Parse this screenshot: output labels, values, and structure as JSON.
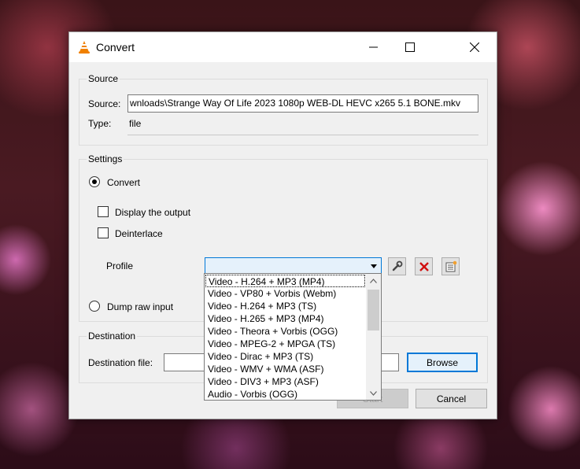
{
  "window": {
    "title": "Convert",
    "icon": "vlc-cone-icon",
    "controls": [
      "minimize-icon",
      "maximize-icon",
      "close-icon"
    ]
  },
  "source": {
    "group_label": "Source",
    "source_label": "Source:",
    "source_value": "wnloads\\Strange Way Of Life 2023 1080p WEB-DL HEVC x265 5.1 BONE.mkv",
    "type_label": "Type:",
    "type_value": "file"
  },
  "settings": {
    "group_label": "Settings",
    "convert_label": "Convert",
    "convert_selected": true,
    "display_output_label": "Display the output",
    "display_output_checked": false,
    "deinterlace_label": "Deinterlace",
    "deinterlace_checked": false,
    "profile_label": "Profile",
    "profile_value": "",
    "profile_buttons": [
      "wrench-icon",
      "delete-x-icon",
      "new-profile-icon"
    ],
    "dump_raw_label": "Dump raw input",
    "dump_raw_selected": false
  },
  "profile_dropdown": {
    "options": [
      "Video - H.264 + MP3 (MP4)",
      "Video - VP80 + Vorbis (Webm)",
      "Video - H.264 + MP3 (TS)",
      "Video - H.265 + MP3 (MP4)",
      "Video - Theora + Vorbis (OGG)",
      "Video - MPEG-2 + MPGA (TS)",
      "Video - Dirac + MP3 (TS)",
      "Video - WMV + WMA (ASF)",
      "Video - DIV3 + MP3 (ASF)",
      "Audio - Vorbis (OGG)"
    ],
    "highlighted_index": 0
  },
  "destination": {
    "group_label": "Destination",
    "file_label": "Destination file:",
    "file_value": "",
    "browse_label": "Browse"
  },
  "footer": {
    "start_label": "Start",
    "cancel_label": "Cancel"
  },
  "colors": {
    "accent": "#0078d7",
    "delete_red": "#d01010",
    "vlc_orange": "#f08000"
  }
}
